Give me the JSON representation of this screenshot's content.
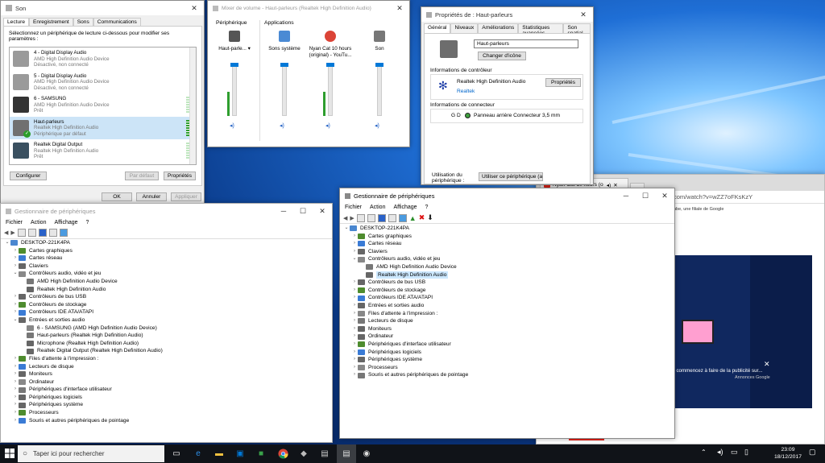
{
  "son": {
    "title": "Son",
    "tabs": [
      "Lecture",
      "Enregistrement",
      "Sons",
      "Communications"
    ],
    "instruction": "Sélectionnez un périphérique de lecture ci-dessous pour modifier ses paramètres :",
    "devices": [
      {
        "name": "4 - Digital Display Audio",
        "sub": "AMD High Definition Audio Device",
        "status": "Désactivé, non connecté"
      },
      {
        "name": "5 - Digital Display Audio",
        "sub": "AMD High Definition Audio Device",
        "status": "Désactivé, non connecté"
      },
      {
        "name": "6 - SAMSUNG",
        "sub": "AMD High Definition Audio Device",
        "status": "Prêt"
      },
      {
        "name": "Haut-parleurs",
        "sub": "Realtek High Definition Audio",
        "status": "Périphérique par défaut"
      },
      {
        "name": "Realtek Digital Output",
        "sub": "Realtek High Definition Audio",
        "status": "Prêt"
      }
    ],
    "configure": "Configurer",
    "default_btn": "Par défaut",
    "properties": "Propriétés",
    "ok": "OK",
    "cancel": "Annuler",
    "apply": "Appliquer"
  },
  "mixer": {
    "title": "Mixer de volume - Haut-parleurs (Realtek High Definition Audio)",
    "device_header": "Périphérique",
    "apps_header": "Applications",
    "channels": [
      {
        "label": "Haut-parle...",
        "level": 0.45
      },
      {
        "label": "Sons système",
        "level": 0.0
      },
      {
        "label": "Nyan Cat 10 hours (original) - YouTu...",
        "level": 0.45
      },
      {
        "label": "Son",
        "level": 0.0
      }
    ]
  },
  "props": {
    "title": "Propriétés de : Haut-parleurs",
    "tabs": [
      "Général",
      "Niveaux",
      "Améliorations",
      "Statistiques avancées",
      "Son spatial"
    ],
    "name_value": "Haut-parleurs",
    "change_icon": "Changer d'icône",
    "controller_header": "Informations de contrôleur",
    "controller_name": "Realtek High Definition Audio",
    "controller_vendor": "Realtek",
    "controller_props": "Propriétés",
    "connector_header": "Informations de connecteur",
    "connector_gd": "G D",
    "connector_value": "Panneau arrière Connecteur 3,5 mm",
    "usage_label": "Utilisation du périphérique :",
    "usage_value": "Utiliser ce périphérique (a"
  },
  "dm_back": {
    "title": "Gestionnaire de périphériques",
    "menu": [
      "Fichier",
      "Action",
      "Affichage",
      "?"
    ],
    "tree": [
      {
        "d": 0,
        "t": "DESKTOP-221K4PA",
        "exp": "v"
      },
      {
        "d": 1,
        "t": "Cartes graphiques",
        "exp": ">"
      },
      {
        "d": 1,
        "t": "Cartes réseau",
        "exp": ">"
      },
      {
        "d": 1,
        "t": "Claviers",
        "exp": ">"
      },
      {
        "d": 1,
        "t": "Contrôleurs audio, vidéo et jeu",
        "exp": "v"
      },
      {
        "d": 2,
        "t": "AMD High Definition Audio Device",
        "exp": ""
      },
      {
        "d": 2,
        "t": "Realtek High Definition Audio",
        "exp": ""
      },
      {
        "d": 1,
        "t": "Contrôleurs de bus USB",
        "exp": ">"
      },
      {
        "d": 1,
        "t": "Contrôleurs de stockage",
        "exp": ">"
      },
      {
        "d": 1,
        "t": "Contrôleurs IDE ATA/ATAPI",
        "exp": ">"
      },
      {
        "d": 1,
        "t": "Entrées et sorties audio",
        "exp": "v"
      },
      {
        "d": 2,
        "t": "6 - SAMSUNG (AMD High Definition Audio Device)",
        "exp": ""
      },
      {
        "d": 2,
        "t": "Haut-parleurs (Realtek High Definition Audio)",
        "exp": ""
      },
      {
        "d": 2,
        "t": "Microphone (Realtek High Definition Audio)",
        "exp": ""
      },
      {
        "d": 2,
        "t": "Realtek Digital Output (Realtek High Definition Audio)",
        "exp": ""
      },
      {
        "d": 1,
        "t": "Files d'attente à l'impression :",
        "exp": ">"
      },
      {
        "d": 1,
        "t": "Lecteurs de disque",
        "exp": ">"
      },
      {
        "d": 1,
        "t": "Moniteurs",
        "exp": ">"
      },
      {
        "d": 1,
        "t": "Ordinateur",
        "exp": ">"
      },
      {
        "d": 1,
        "t": "Périphériques d'interface utilisateur",
        "exp": ">"
      },
      {
        "d": 1,
        "t": "Périphériques logiciels",
        "exp": ">"
      },
      {
        "d": 1,
        "t": "Périphériques système",
        "exp": ">"
      },
      {
        "d": 1,
        "t": "Processeurs",
        "exp": ">"
      },
      {
        "d": 1,
        "t": "Souris et autres périphériques de pointage",
        "exp": ">"
      }
    ]
  },
  "dm_front": {
    "title": "Gestionnaire de périphériques",
    "menu": [
      "Fichier",
      "Action",
      "Affichage",
      "?"
    ],
    "tree": [
      {
        "d": 0,
        "t": "DESKTOP-221K4PA",
        "exp": "v"
      },
      {
        "d": 1,
        "t": "Cartes graphiques",
        "exp": ">"
      },
      {
        "d": 1,
        "t": "Cartes réseau",
        "exp": ">"
      },
      {
        "d": 1,
        "t": "Claviers",
        "exp": ">"
      },
      {
        "d": 1,
        "t": "Contrôleurs audio, vidéo et jeu",
        "exp": "v"
      },
      {
        "d": 2,
        "t": "AMD High Definition Audio Device",
        "exp": ""
      },
      {
        "d": 2,
        "t": "Realtek High Definition Audio",
        "exp": "",
        "sel": true
      },
      {
        "d": 1,
        "t": "Contrôleurs de bus USB",
        "exp": ">"
      },
      {
        "d": 1,
        "t": "Contrôleurs de stockage",
        "exp": ">"
      },
      {
        "d": 1,
        "t": "Contrôleurs IDE ATA/ATAPI",
        "exp": ">"
      },
      {
        "d": 1,
        "t": "Entrées et sorties audio",
        "exp": ">"
      },
      {
        "d": 1,
        "t": "Files d'attente à l'impression :",
        "exp": ">"
      },
      {
        "d": 1,
        "t": "Lecteurs de disque",
        "exp": ">"
      },
      {
        "d": 1,
        "t": "Moniteurs",
        "exp": ">"
      },
      {
        "d": 1,
        "t": "Ordinateur",
        "exp": ">"
      },
      {
        "d": 1,
        "t": "Périphériques d'interface utilisateur",
        "exp": ">"
      },
      {
        "d": 1,
        "t": "Périphériques logiciels",
        "exp": ">"
      },
      {
        "d": 1,
        "t": "Périphériques système",
        "exp": ">"
      },
      {
        "d": 1,
        "t": "Processeurs",
        "exp": ">"
      },
      {
        "d": 1,
        "t": "Souris et autres périphériques de pointage",
        "exp": ">"
      }
    ]
  },
  "browser": {
    "tab_title": "Nyan Cat 10 hours (o",
    "url_fragment": "com/watch?v=wZZ7oFKsKzY",
    "subtitle_fragment": "ube, une filiale de Google",
    "ad_text": "t commencez à faire de la publicité sur...",
    "ad_source": "Annonces Google",
    "close": "✕"
  },
  "taskbar": {
    "search_placeholder": "Taper ici pour rechercher",
    "time": "23:09",
    "date": "18/12/2017"
  }
}
